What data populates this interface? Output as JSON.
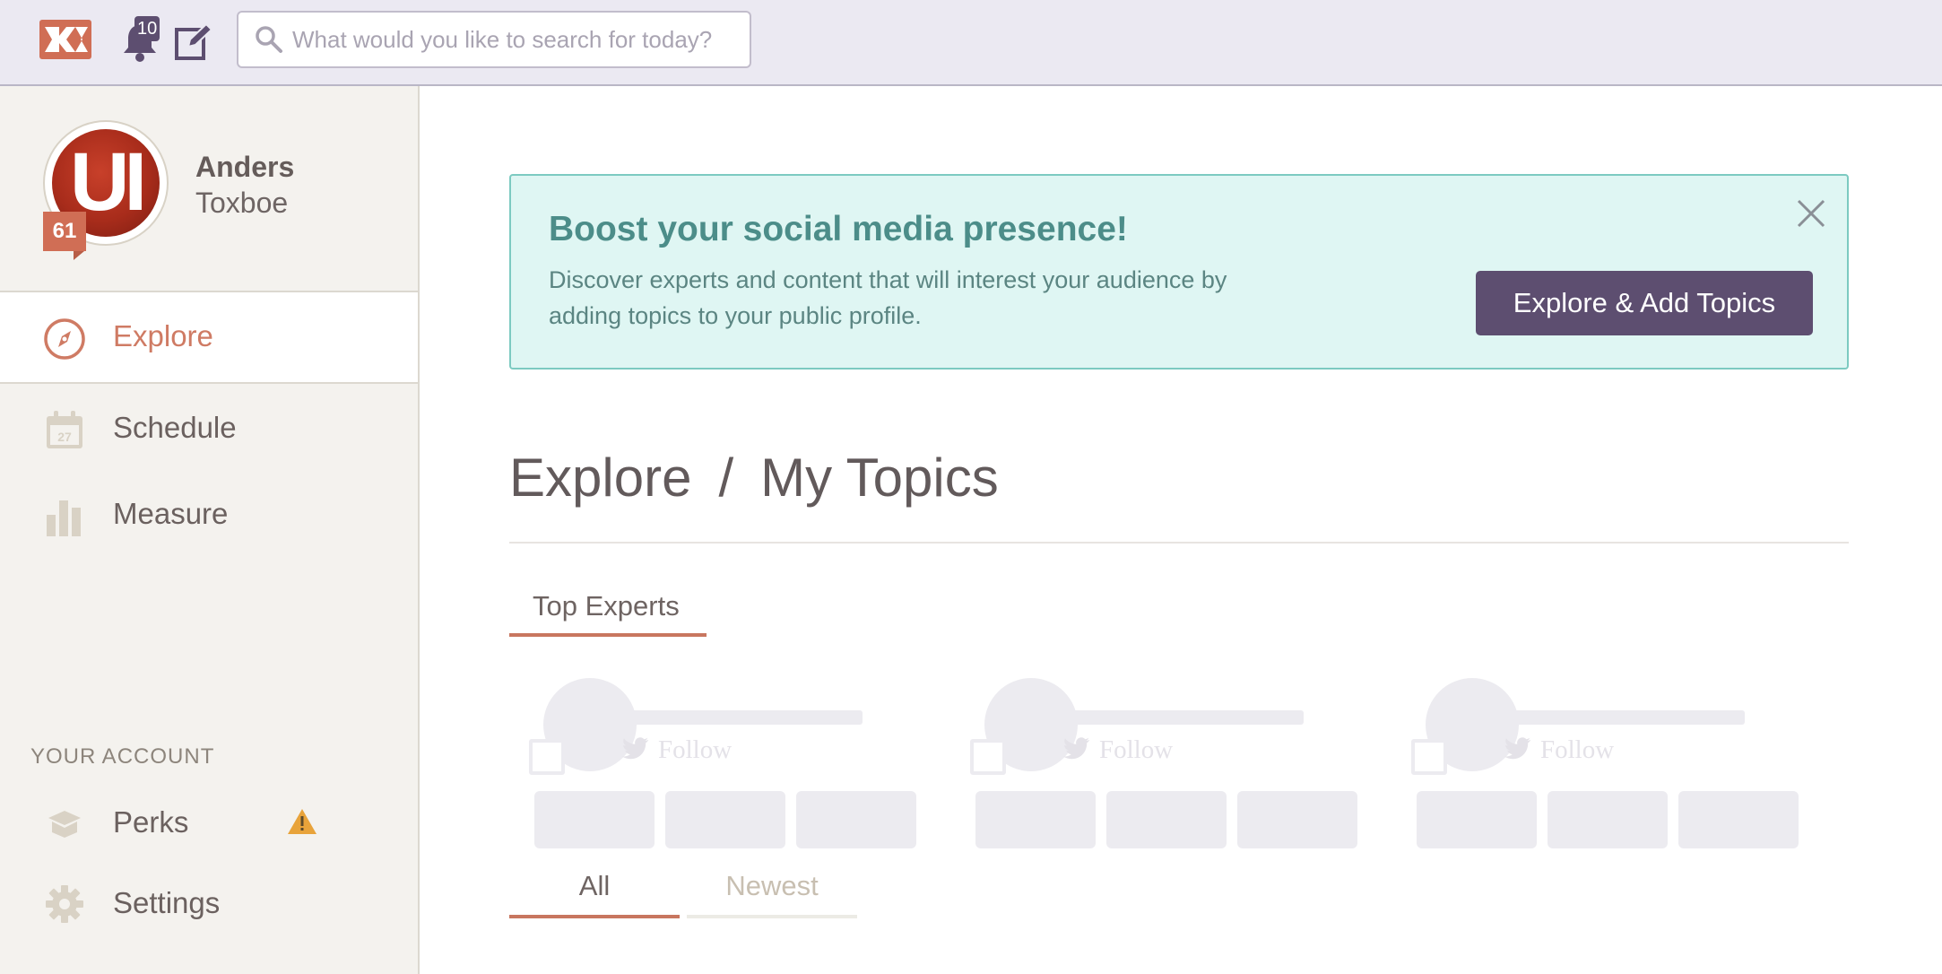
{
  "header": {
    "logo_label": "Klout",
    "notification_count": "10",
    "search_placeholder": "What would you like to search for today?"
  },
  "profile": {
    "avatar_text": "UI",
    "score": "61",
    "first_name": "Anders",
    "last_name": "Toxboe"
  },
  "sidebar": {
    "nav": [
      {
        "label": "Explore",
        "icon": "compass-icon",
        "active": true
      },
      {
        "label": "Schedule",
        "icon": "calendar-icon",
        "calendar_day": "27"
      },
      {
        "label": "Measure",
        "icon": "bar-chart-icon"
      }
    ],
    "account_title": "YOUR ACCOUNT",
    "account_items": [
      {
        "label": "Perks",
        "icon": "gift-icon",
        "warning": true
      },
      {
        "label": "Settings",
        "icon": "gear-icon"
      }
    ]
  },
  "banner": {
    "title": "Boost your social media presence!",
    "description": "Discover experts and content that will interest your audience by adding topics to your public profile.",
    "button_label": "Explore & Add Topics"
  },
  "breadcrumb": {
    "root": "Explore",
    "separator": "/",
    "current": "My Topics"
  },
  "top_tab": "Top Experts",
  "expert_cards": [
    {
      "follow_label": "Follow"
    },
    {
      "follow_label": "Follow"
    },
    {
      "follow_label": "Follow"
    }
  ],
  "content_tabs": {
    "all": "All",
    "newest": "Newest"
  },
  "colors": {
    "accent": "#cf7b64",
    "brand_purple": "#5d4e70",
    "banner_bg": "#dff6f3",
    "banner_text": "#4c8d89",
    "warning": "#e8a33a"
  }
}
